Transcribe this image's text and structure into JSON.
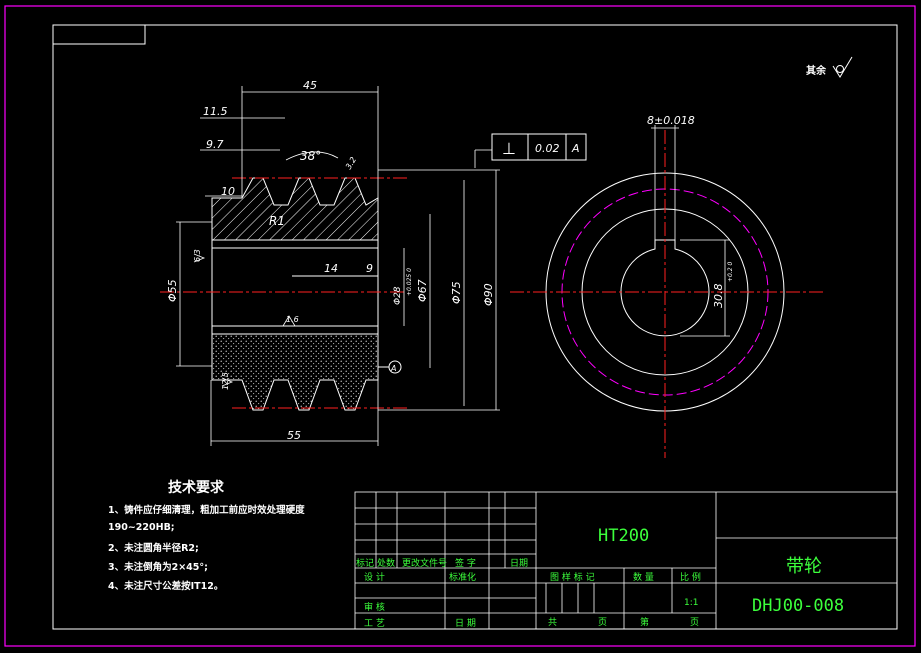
{
  "surface_finish": {
    "label": "其余"
  },
  "dims": {
    "width_45": "45",
    "d_11_5": "11.5",
    "d_9_7": "9.7",
    "angle_38": "38°",
    "d_10": "10",
    "r1": "R1",
    "d_14": "14",
    "d_9": "9",
    "phi55": "Φ55",
    "phi28": "Φ28",
    "phi28_tol": "+0.025 0",
    "phi67": "Φ67",
    "phi75": "Φ75",
    "phi90": "Φ90",
    "width_55": "55",
    "rough_6_3": "6.3",
    "rough_1_6": "1.6",
    "rough_12_5": "12.5",
    "rough_3_2": "3.2",
    "key_width": "8±0.018",
    "key_depth": "30.8",
    "key_depth_tol": "+0.2 0"
  },
  "tolerance_frame": {
    "symbol": "⊥",
    "value": "0.02",
    "datum": "A"
  },
  "datum_marker": "A",
  "tech_req": {
    "title": "技术要求",
    "items": [
      "1、铸件应仔细清理，粗加工前应时效处理硬度",
      "   190~220HB;",
      "2、未注圆角半径R2;",
      "3、未注倒角为2×45°;",
      "4、未注尺寸公差按IT12。"
    ]
  },
  "title_block": {
    "material": "HT200",
    "part_name": "带轮",
    "drawing_no": "DHJ00-008",
    "rev_headers": [
      "标记",
      "处数",
      "更改文件号",
      "签 字",
      "日期"
    ],
    "design": "设 计",
    "standardize": "标准化",
    "check": "审 核",
    "process": "工 艺",
    "date": "日 期",
    "stage_mark": "图 样 标 记",
    "quantity": "数 量",
    "scale_label": "比 例",
    "scale_value": "1:1",
    "total": "共",
    "page": "页",
    "sheet": "第",
    "page2": "页"
  },
  "colors": {
    "frame": "#ff00ff",
    "geometry": "#ffffff",
    "centerline": "#ff2020",
    "hidden_pitch": "#ff00ff",
    "titleblock_text": "#3cff3c"
  }
}
